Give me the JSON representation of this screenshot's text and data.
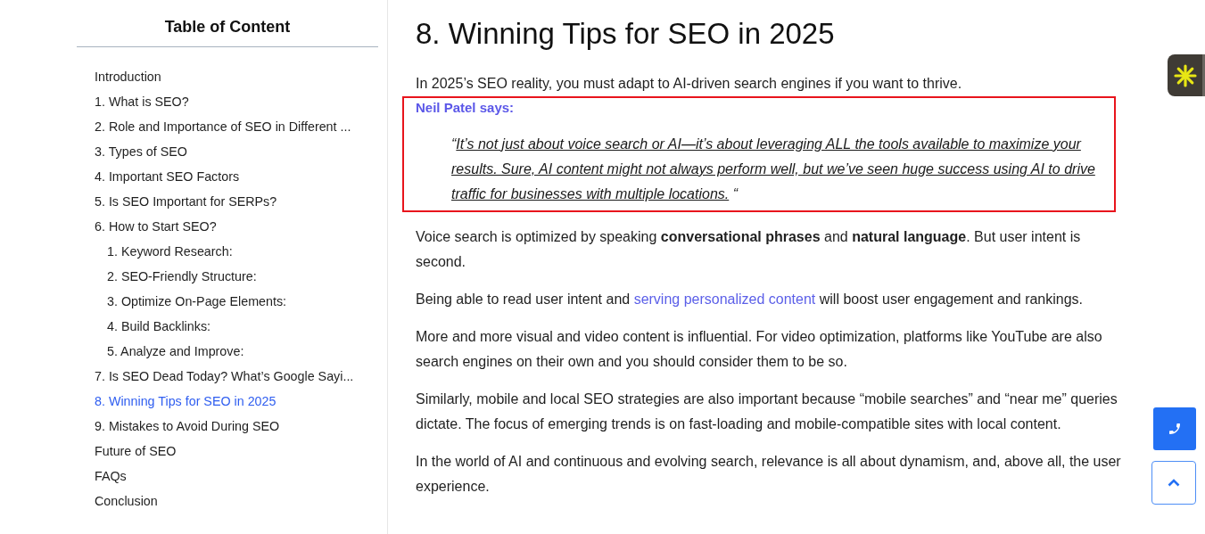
{
  "toc": {
    "title": "Table of Content",
    "items": [
      {
        "label": "Introduction",
        "selected": false
      },
      {
        "label": "1. What is SEO?",
        "selected": false
      },
      {
        "label": "2. Role and Importance of SEO in Different ...",
        "selected": false
      },
      {
        "label": "3. Types of SEO",
        "selected": false
      },
      {
        "label": "4. Important SEO Factors",
        "selected": false
      },
      {
        "label": "5. Is SEO Important for SERPs?",
        "selected": false
      },
      {
        "label": "6. How to Start SEO?",
        "selected": false,
        "children": [
          {
            "label": "1. Keyword Research:",
            "selected": false
          },
          {
            "label": "2. SEO-Friendly Structure:",
            "selected": false
          },
          {
            "label": "3. Optimize On-Page Elements:",
            "selected": false
          },
          {
            "label": "4. Build Backlinks:",
            "selected": false
          },
          {
            "label": "5. Analyze and Improve:",
            "selected": false
          }
        ]
      },
      {
        "label": "7. Is SEO Dead Today? What’s Google Sayi...",
        "selected": false
      },
      {
        "label": "8. Winning Tips for SEO in 2025",
        "selected": true
      },
      {
        "label": "9. Mistakes to Avoid During SEO",
        "selected": false
      },
      {
        "label": "Future of SEO",
        "selected": false
      },
      {
        "label": "FAQs",
        "selected": false
      },
      {
        "label": "Conclusion",
        "selected": false
      }
    ]
  },
  "article": {
    "heading": "8. Winning Tips for SEO in 2025",
    "intro": "In 2025’s SEO reality, you must adapt to AI-driven search engines if you want to thrive.",
    "quote": {
      "author": "Neil Patel says:",
      "open": "“",
      "text": "It’s not just about voice search or AI—it’s about leveraging ALL the tools available to maximize your results. Sure, AI content might not always perform well, but we’ve seen huge success using AI to drive traffic for businesses with multiple locations.",
      "close": " “"
    },
    "paragraphs": [
      [
        {
          "kind": "text",
          "text": "Voice search is optimized by speaking **conversational phrases** and **natural language**. But user intent is second."
        }
      ],
      [
        {
          "kind": "text",
          "text": "Being able to read user intent and "
        },
        {
          "kind": "link",
          "text": "serving personalized content"
        },
        {
          "kind": "text",
          "text": " will boost user engagement and rankings."
        }
      ],
      [
        {
          "kind": "text",
          "text": "More and more visual and video content is influential. For video optimization, platforms like YouTube are also search engines on their own and you should consider them to be so."
        }
      ],
      [
        {
          "kind": "text",
          "text": "Similarly, mobile and local SEO strategies are also important because “mobile searches” and “near me” queries dictate. The focus of emerging trends is on fast-loading and mobile-compatible sites with local content."
        }
      ],
      [
        {
          "kind": "text",
          "text": "In the world of AI and continuous and evolving search, relevance is all about dynamism, and, above all, the user experience."
        }
      ]
    ]
  }
}
